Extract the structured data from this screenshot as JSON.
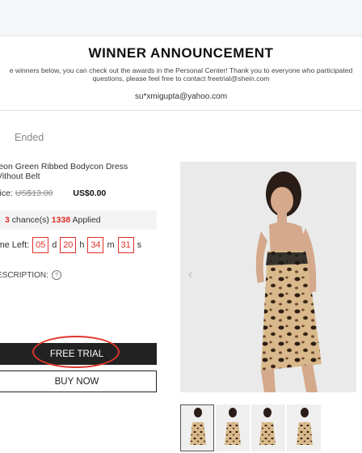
{
  "announcement": {
    "title": "WINNER ANNOUNCEMENT",
    "desc_line1": "e winners below, you can check out the awards in the Personal Center! Thank you to everyone who participated",
    "desc_line2": "questions, please feel free to contact freetrial@shein.com",
    "email": "su*xmigupta@yahoo.com"
  },
  "product": {
    "status": "Ended",
    "name_line1": "leon Green Ribbed Bodycon Dress",
    "name_line2": "Vithout Belt",
    "price_label": "rice:",
    "original_price": "US$13.00",
    "current_price": "US$0.00",
    "chances_count": "3",
    "chances_label": "chance(s)",
    "applied_count": "1338",
    "applied_label": "Applied",
    "time_label": "ime Left:",
    "time": {
      "days": "05",
      "d": "d",
      "hours": "20",
      "h": "h",
      "minutes": "34",
      "m": "m",
      "seconds": "31",
      "s": "s"
    },
    "description_label": "ESCRIPTION:",
    "free_trial_label": "FREE TRIAL",
    "buy_now_label": "BUY NOW"
  },
  "icons": {
    "help": "question-circle-icon",
    "prev": "chevron-left-icon"
  },
  "colors": {
    "accent_red": "#e0302a",
    "button_dark": "#222222"
  }
}
